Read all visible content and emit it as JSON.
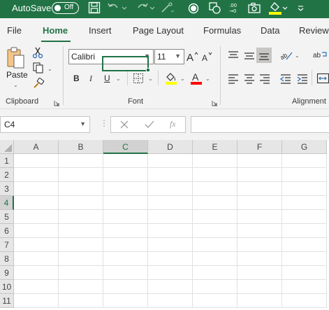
{
  "titlebar": {
    "autosave_label": "AutoSave",
    "autosave_state": "Off",
    "accent_color": "#217346"
  },
  "tabs": [
    {
      "label": "File"
    },
    {
      "label": "Home"
    },
    {
      "label": "Insert"
    },
    {
      "label": "Page Layout"
    },
    {
      "label": "Formulas"
    },
    {
      "label": "Data"
    },
    {
      "label": "Review"
    }
  ],
  "active_tab": "Home",
  "ribbon": {
    "clipboard": {
      "label": "Clipboard",
      "paste_label": "Paste"
    },
    "font": {
      "label": "Font",
      "font_name": "Calibri",
      "font_size": "11",
      "bold": "B",
      "italic": "I",
      "underline": "U",
      "fill_color": "#ffff00",
      "font_color": "#ff0000"
    },
    "alignment": {
      "label": "Alignment"
    }
  },
  "formula_bar": {
    "name_box": "C4",
    "insert_function": "fx",
    "formula": ""
  },
  "sheet": {
    "columns": [
      "A",
      "B",
      "C",
      "D",
      "E",
      "F",
      "G"
    ],
    "rows": [
      "1",
      "2",
      "3",
      "4",
      "5",
      "6",
      "7",
      "8",
      "9",
      "10",
      "11"
    ],
    "active_cell": "C4",
    "selected_column": "C",
    "selected_row": "4"
  }
}
